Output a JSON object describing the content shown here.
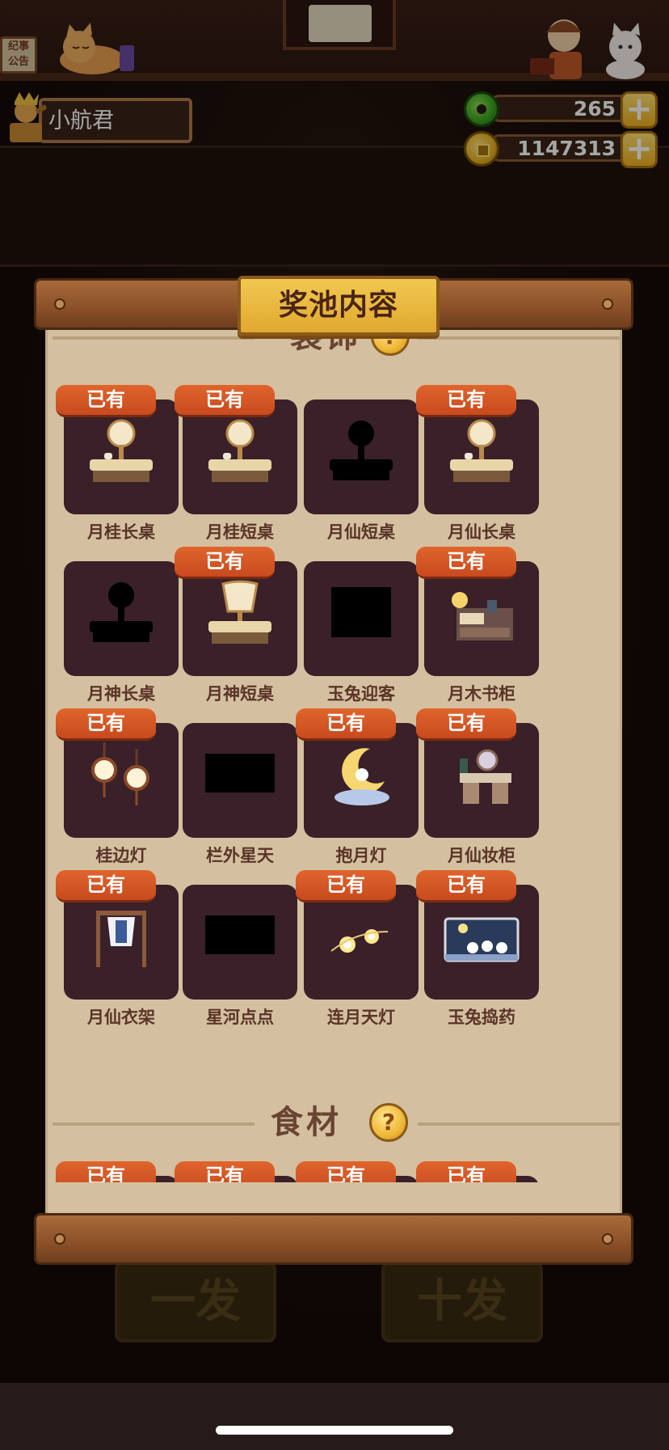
{
  "hud": {
    "notice_board_text": "纪事 公告",
    "player_name": "小航君",
    "jade_amount": "265",
    "coin_amount": "1147313"
  },
  "modal": {
    "title": "奖池内容",
    "section_decor": "装饰",
    "section_food": "食材"
  },
  "owned_label": "已有",
  "items": [
    {
      "name": "月桂长桌",
      "owned": true,
      "art": "desk-lamp"
    },
    {
      "name": "月桂短桌",
      "owned": true,
      "art": "desk-lamp"
    },
    {
      "name": "月仙短桌",
      "owned": false,
      "art": "silhouette-desk"
    },
    {
      "name": "月仙长桌",
      "owned": true,
      "art": "desk-lamp"
    },
    {
      "name": "月神长桌",
      "owned": false,
      "art": "silhouette-desk"
    },
    {
      "name": "月神短桌",
      "owned": true,
      "art": "desk-fan"
    },
    {
      "name": "玉兔迎客",
      "owned": false,
      "art": "silhouette-block"
    },
    {
      "name": "月木书柜",
      "owned": true,
      "art": "bookcase"
    },
    {
      "name": "桂边灯",
      "owned": true,
      "art": "lanterns"
    },
    {
      "name": "栏外星天",
      "owned": false,
      "art": "silhouette-wide"
    },
    {
      "name": "抱月灯",
      "owned": true,
      "art": "moon-lamp"
    },
    {
      "name": "月仙妆柜",
      "owned": true,
      "art": "vanity"
    },
    {
      "name": "月仙衣架",
      "owned": true,
      "art": "clothes-rack"
    },
    {
      "name": "星河点点",
      "owned": false,
      "art": "silhouette-wide"
    },
    {
      "name": "连月天灯",
      "owned": true,
      "art": "sky-lanterns"
    },
    {
      "name": "玉兔捣药",
      "owned": true,
      "art": "rabbit-painting"
    }
  ],
  "food_items_partial": [
    {
      "owned": true
    },
    {
      "owned": true
    },
    {
      "owned": true
    },
    {
      "owned": true
    }
  ],
  "background_buttons": {
    "single_draw": "一发",
    "ten_draw": "十发"
  }
}
